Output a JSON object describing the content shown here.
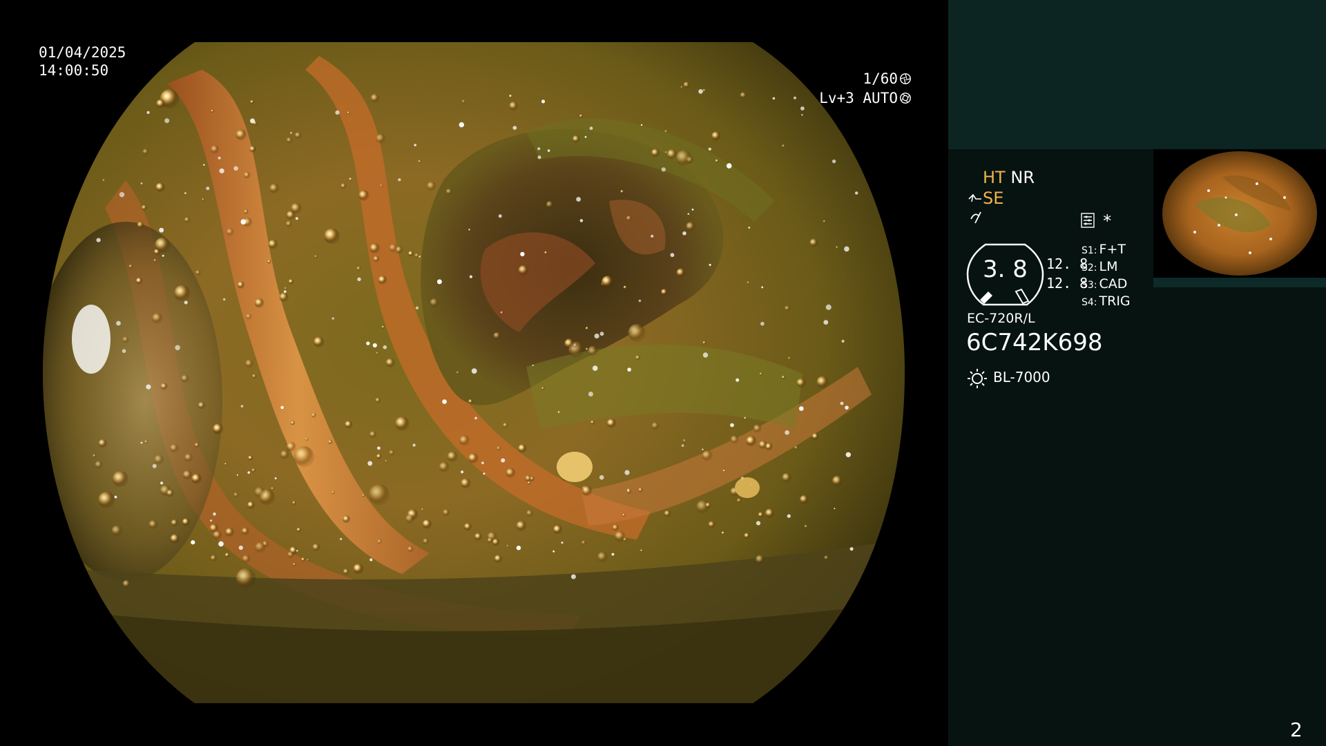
{
  "overlay": {
    "date": "01/04/2025",
    "time": "14:00:50",
    "shutter": "1/60",
    "shutter_icon": "shutter-icon",
    "brightness": "Lv+3 AUTO",
    "brightness_icon": "iris-icon"
  },
  "panel": {
    "ht_label": "HT",
    "nr_label": "NR",
    "se_label": "SE",
    "se_icon": "scope-se-icon",
    "wave_icon": "waveform-icon",
    "settings_icon": "settings-sliders-icon",
    "asterisk": "*",
    "gauge_value": "3. 8",
    "zoom_top": "12. 8",
    "zoom_bottom": "12. 8",
    "switches": [
      {
        "key": "S1:",
        "value": "F+T"
      },
      {
        "key": "S2:",
        "value": "LM"
      },
      {
        "key": "S3:",
        "value": "CAD"
      },
      {
        "key": "S4:",
        "value": "TRIG"
      }
    ],
    "scope_model": "EC-720R/L",
    "serial": "6C742K698",
    "lamp_icon": "light-source-icon",
    "lamp_label": "BL-7000",
    "page_number": "2"
  },
  "colors": {
    "panel_bg": "#061311",
    "panel_top": "#0c2523",
    "accent_orange": "#f3b24a"
  }
}
